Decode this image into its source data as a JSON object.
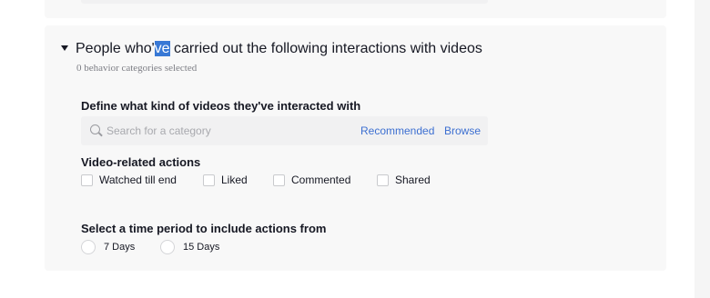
{
  "header": {
    "title_pre": "People who'",
    "title_selected": "ve",
    "title_post": " carried out the following interactions with videos",
    "subtitle": "0 behavior categories selected"
  },
  "define_section": {
    "label": "Define what kind of videos they've interacted with",
    "search_placeholder": "Search for a category",
    "recommended_label": "Recommended",
    "browse_label": "Browse"
  },
  "video_actions": {
    "label": "Video-related actions",
    "options": [
      {
        "label": "Watched till end",
        "checked": false
      },
      {
        "label": "Liked",
        "checked": false
      },
      {
        "label": "Commented",
        "checked": false
      },
      {
        "label": "Shared",
        "checked": false
      }
    ]
  },
  "time_period": {
    "label": "Select a time period to include actions from",
    "options": [
      {
        "label": "7 Days",
        "selected": false
      },
      {
        "label": "15 Days",
        "selected": false
      }
    ]
  },
  "colors": {
    "link": "#3c6fd1",
    "text_selection": "#3878d5",
    "card_background": "#f8f8f8"
  }
}
